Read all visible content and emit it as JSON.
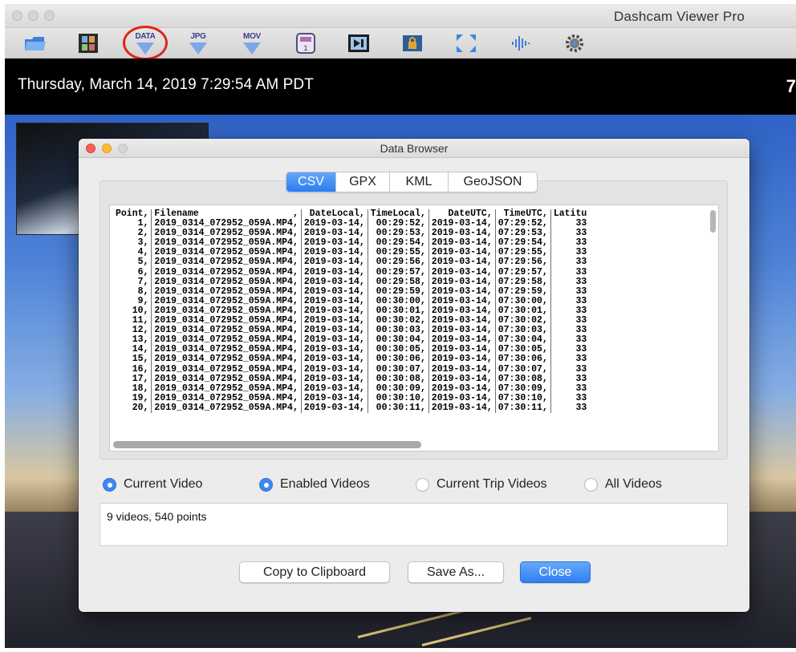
{
  "window": {
    "title": "Dashcam Viewer Pro"
  },
  "toolbar": {
    "items": [
      {
        "name": "open-folder",
        "label": ""
      },
      {
        "name": "film-strip",
        "label": ""
      },
      {
        "name": "export-data",
        "label": "DATA"
      },
      {
        "name": "export-jpg",
        "label": "JPG"
      },
      {
        "name": "export-mov",
        "label": "MOV"
      },
      {
        "name": "single-frame",
        "label": ""
      },
      {
        "name": "next-clip",
        "label": ""
      },
      {
        "name": "lock",
        "label": ""
      },
      {
        "name": "fullscreen",
        "label": ""
      },
      {
        "name": "audio",
        "label": ""
      },
      {
        "name": "settings",
        "label": ""
      }
    ],
    "single_frame_number": "1"
  },
  "video": {
    "timestamp": "Thursday, March 14, 2019 7:29:54 AM PDT",
    "speed_partial": "7"
  },
  "dialog": {
    "title": "Data Browser",
    "tabs": [
      "CSV",
      "GPX",
      "KML",
      "GeoJSON"
    ],
    "active_tab": "CSV",
    "csv": {
      "headers": [
        "Point,",
        "Filename",
        ",",
        "DateLocal,",
        "TimeLocal,",
        "DateUTC,",
        "TimeUTC,",
        "Latitu"
      ],
      "rows": [
        [
          "1,",
          "2019_0314_072952_059A.MP4,",
          "2019-03-14,",
          "00:29:52,",
          "2019-03-14,",
          "07:29:52,",
          "33"
        ],
        [
          "2,",
          "2019_0314_072952_059A.MP4,",
          "2019-03-14,",
          "00:29:53,",
          "2019-03-14,",
          "07:29:53,",
          "33"
        ],
        [
          "3,",
          "2019_0314_072952_059A.MP4,",
          "2019-03-14,",
          "00:29:54,",
          "2019-03-14,",
          "07:29:54,",
          "33"
        ],
        [
          "4,",
          "2019_0314_072952_059A.MP4,",
          "2019-03-14,",
          "00:29:55,",
          "2019-03-14,",
          "07:29:55,",
          "33"
        ],
        [
          "5,",
          "2019_0314_072952_059A.MP4,",
          "2019-03-14,",
          "00:29:56,",
          "2019-03-14,",
          "07:29:56,",
          "33"
        ],
        [
          "6,",
          "2019_0314_072952_059A.MP4,",
          "2019-03-14,",
          "00:29:57,",
          "2019-03-14,",
          "07:29:57,",
          "33"
        ],
        [
          "7,",
          "2019_0314_072952_059A.MP4,",
          "2019-03-14,",
          "00:29:58,",
          "2019-03-14,",
          "07:29:58,",
          "33"
        ],
        [
          "8,",
          "2019_0314_072952_059A.MP4,",
          "2019-03-14,",
          "00:29:59,",
          "2019-03-14,",
          "07:29:59,",
          "33"
        ],
        [
          "9,",
          "2019_0314_072952_059A.MP4,",
          "2019-03-14,",
          "00:30:00,",
          "2019-03-14,",
          "07:30:00,",
          "33"
        ],
        [
          "10,",
          "2019_0314_072952_059A.MP4,",
          "2019-03-14,",
          "00:30:01,",
          "2019-03-14,",
          "07:30:01,",
          "33"
        ],
        [
          "11,",
          "2019_0314_072952_059A.MP4,",
          "2019-03-14,",
          "00:30:02,",
          "2019-03-14,",
          "07:30:02,",
          "33"
        ],
        [
          "12,",
          "2019_0314_072952_059A.MP4,",
          "2019-03-14,",
          "00:30:03,",
          "2019-03-14,",
          "07:30:03,",
          "33"
        ],
        [
          "13,",
          "2019_0314_072952_059A.MP4,",
          "2019-03-14,",
          "00:30:04,",
          "2019-03-14,",
          "07:30:04,",
          "33"
        ],
        [
          "14,",
          "2019_0314_072952_059A.MP4,",
          "2019-03-14,",
          "00:30:05,",
          "2019-03-14,",
          "07:30:05,",
          "33"
        ],
        [
          "15,",
          "2019_0314_072952_059A.MP4,",
          "2019-03-14,",
          "00:30:06,",
          "2019-03-14,",
          "07:30:06,",
          "33"
        ],
        [
          "16,",
          "2019_0314_072952_059A.MP4,",
          "2019-03-14,",
          "00:30:07,",
          "2019-03-14,",
          "07:30:07,",
          "33"
        ],
        [
          "17,",
          "2019_0314_072952_059A.MP4,",
          "2019-03-14,",
          "00:30:08,",
          "2019-03-14,",
          "07:30:08,",
          "33"
        ],
        [
          "18,",
          "2019_0314_072952_059A.MP4,",
          "2019-03-14,",
          "00:30:09,",
          "2019-03-14,",
          "07:30:09,",
          "33"
        ],
        [
          "19,",
          "2019_0314_072952_059A.MP4,",
          "2019-03-14,",
          "00:30:10,",
          "2019-03-14,",
          "07:30:10,",
          "33"
        ],
        [
          "20,",
          "2019_0314_072952_059A.MP4,",
          "2019-03-14,",
          "00:30:11,",
          "2019-03-14,",
          "07:30:11,",
          "33"
        ]
      ]
    },
    "radios": [
      {
        "label": "Current Video",
        "selected": true
      },
      {
        "label": "Enabled Videos",
        "selected": true
      },
      {
        "label": "Current Trip Videos",
        "selected": false
      },
      {
        "label": "All Videos",
        "selected": false
      }
    ],
    "status": "9 videos, 540 points",
    "buttons": {
      "copy": "Copy to Clipboard",
      "save": "Save As...",
      "close": "Close"
    }
  },
  "colors": {
    "accent": "#2f7ff3",
    "highlight_ring": "#e0251b"
  }
}
